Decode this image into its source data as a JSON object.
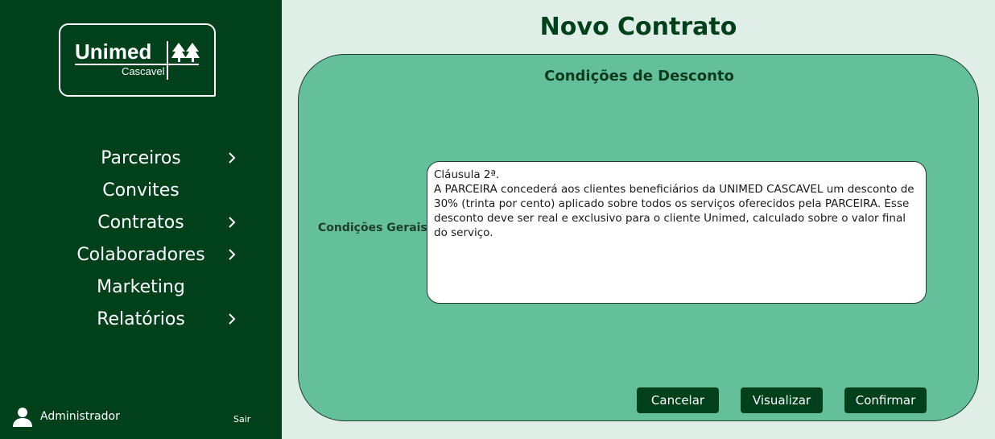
{
  "sidebar": {
    "logo": {
      "brand": "Unimed",
      "city": "Cascavel"
    },
    "nav": [
      {
        "label": "Parceiros",
        "has_submenu": true
      },
      {
        "label": "Convites",
        "has_submenu": false
      },
      {
        "label": "Contratos",
        "has_submenu": true
      },
      {
        "label": "Colaboradores",
        "has_submenu": true
      },
      {
        "label": "Marketing",
        "has_submenu": false
      },
      {
        "label": "Relatórios",
        "has_submenu": true
      }
    ],
    "user": {
      "name": "Administrador",
      "logout_label": "Sair"
    }
  },
  "main": {
    "title": "Novo Contrato",
    "section_title": "Condições de Desconto",
    "field_label": "Condições Gerais:",
    "field_value": "Cláusula 2ª.\nA PARCEIRA concederá aos clientes beneficiários da UNIMED CASCAVEL um desconto de 30% (trinta por cento) aplicado sobre todos os serviços oferecidos pela PARCEIRA. Esse desconto deve ser real e exclusivo para o cliente Unimed, calculado sobre o valor final do serviço.",
    "buttons": {
      "cancel": "Cancelar",
      "preview": "Visualizar",
      "confirm": "Confirmar"
    }
  },
  "colors": {
    "sidebar_bg": "#00401a",
    "page_bg": "#dfefe7",
    "card_bg": "#63c09b",
    "button_bg": "#00401a",
    "title_color": "#00401a"
  }
}
